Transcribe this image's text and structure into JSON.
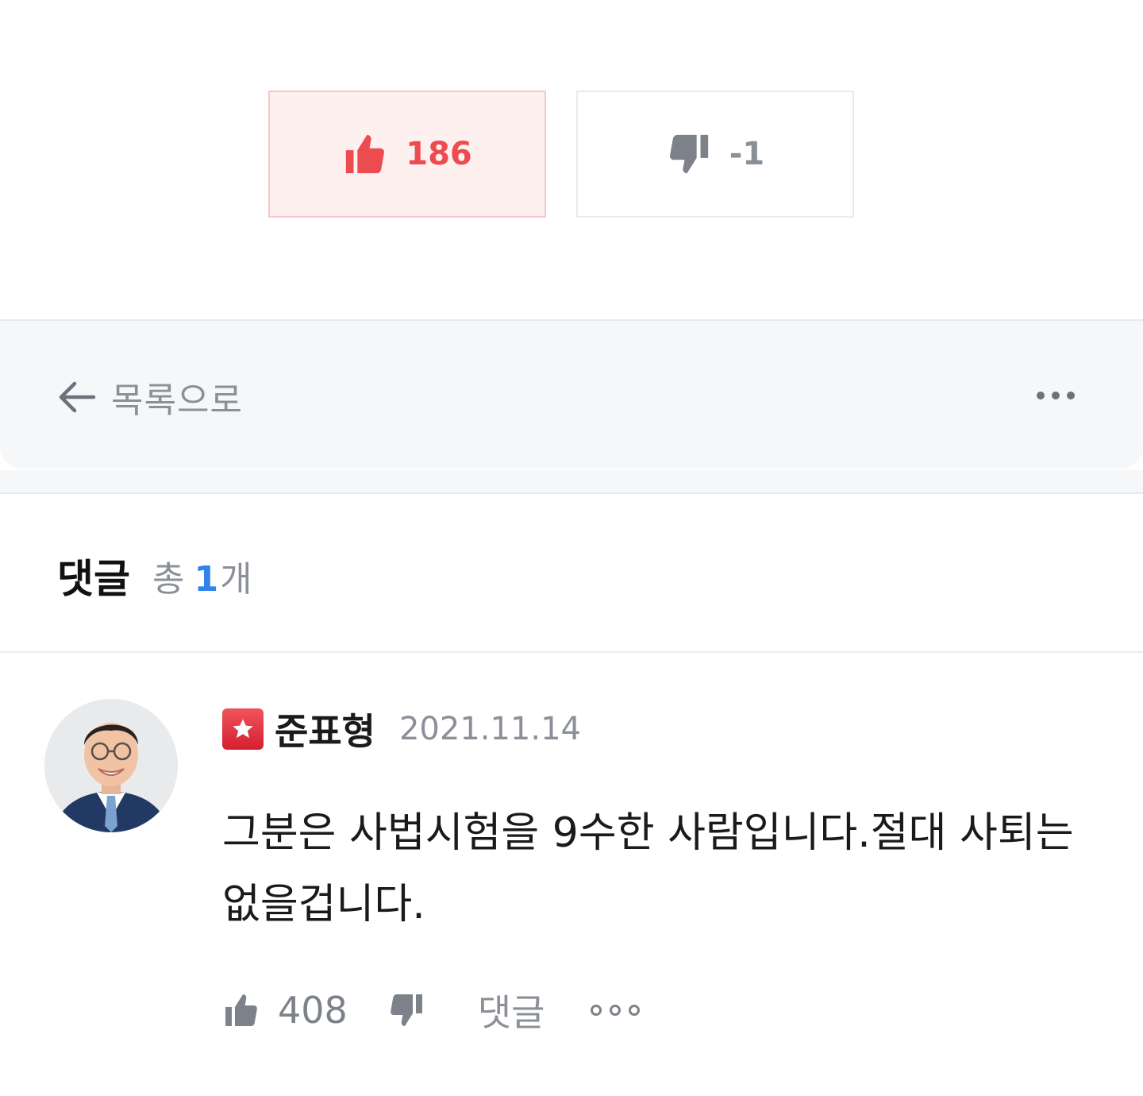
{
  "votes": {
    "like_count": "186",
    "dislike_count": "-1"
  },
  "nav": {
    "back_label": "목록으로"
  },
  "comments": {
    "title": "댓글",
    "total_prefix": "총",
    "total_count": "1",
    "total_suffix": "개"
  },
  "comment": {
    "author": "준표형",
    "date": "2021.11.14",
    "text": "그분은 사법시험을 9수한 사람입니다.절대 사퇴는 없을겁니다.",
    "like_count": "408",
    "reply_label": "댓글"
  },
  "colors": {
    "accent_red": "#ec4b4f",
    "accent_blue": "#2f83ea",
    "muted": "#8b9098"
  }
}
